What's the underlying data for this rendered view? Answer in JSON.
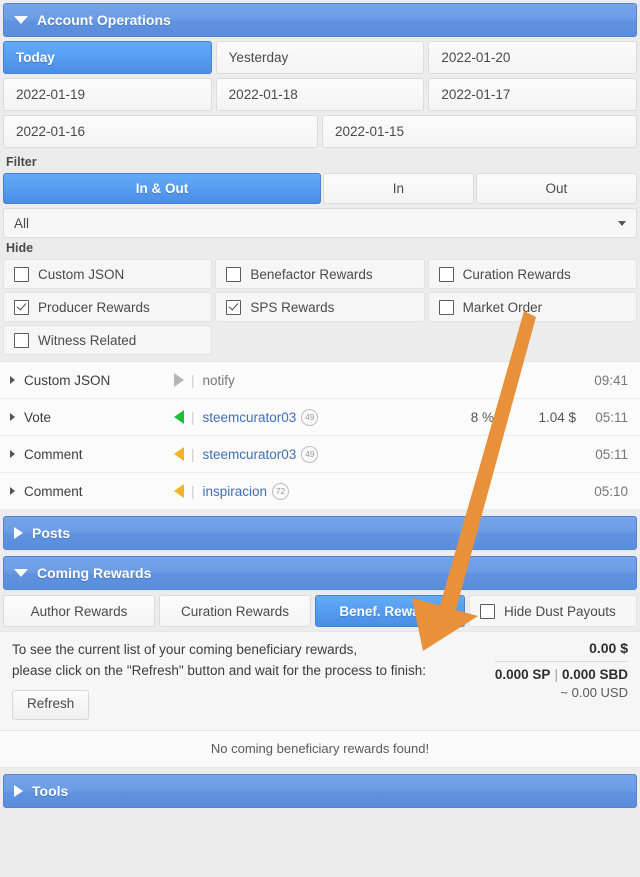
{
  "colors": {
    "header_blue": "#6c9ce5",
    "active_blue": "#58a0f2",
    "arrow_orange": "#e8913a",
    "link_blue": "#3f6fb5",
    "in_green": "#1fbf3e",
    "out_yellow": "#f0b429"
  },
  "account_operations": {
    "title": "Account Operations",
    "collapse_state": "expanded",
    "date_buttons": [
      [
        {
          "label": "Today",
          "active": true
        },
        {
          "label": "Yesterday",
          "active": false
        },
        {
          "label": "2022-01-20",
          "active": false
        }
      ],
      [
        {
          "label": "2022-01-19",
          "active": false
        },
        {
          "label": "2022-01-18",
          "active": false
        },
        {
          "label": "2022-01-17",
          "active": false
        }
      ],
      [
        {
          "label": "2022-01-16",
          "active": false
        },
        {
          "label": "2022-01-15",
          "active": false
        }
      ]
    ],
    "filter_label": "Filter",
    "filter_buttons": [
      {
        "label": "In & Out",
        "active": true
      },
      {
        "label": "In",
        "active": false
      },
      {
        "label": "Out",
        "active": false
      }
    ],
    "filter_select": {
      "value": "All",
      "icon": "chevron-down-icon"
    },
    "hide_label": "Hide",
    "hide_checkboxes": [
      [
        {
          "label": "Custom JSON",
          "checked": false
        },
        {
          "label": "Benefactor Rewards",
          "checked": false
        },
        {
          "label": "Curation Rewards",
          "checked": false
        }
      ],
      [
        {
          "label": "Producer Rewards",
          "checked": true
        },
        {
          "label": "SPS Rewards",
          "checked": true
        },
        {
          "label": "Market Order",
          "checked": false
        }
      ],
      [
        {
          "label": "Witness Related",
          "checked": false
        }
      ]
    ],
    "operations": [
      {
        "type": "Custom JSON",
        "direction": "none",
        "user": "notify",
        "user_is_link": false,
        "reputation": "",
        "percent": "",
        "amount": "",
        "time": "09:41"
      },
      {
        "type": "Vote",
        "direction": "in",
        "user": "steemcurator03",
        "user_is_link": true,
        "reputation": "49",
        "percent": "8 %",
        "amount": "1.04 $",
        "time": "05:11"
      },
      {
        "type": "Comment",
        "direction": "out",
        "user": "steemcurator03",
        "user_is_link": true,
        "reputation": "49",
        "percent": "",
        "amount": "",
        "time": "05:11"
      },
      {
        "type": "Comment",
        "direction": "out",
        "user": "inspiracion",
        "user_is_link": true,
        "reputation": "72",
        "percent": "",
        "amount": "",
        "time": "05:10"
      }
    ]
  },
  "posts_section": {
    "title": "Posts",
    "collapse_state": "collapsed"
  },
  "coming_rewards": {
    "title": "Coming Rewards",
    "collapse_state": "expanded",
    "tabs": [
      {
        "label": "Author Rewards",
        "active": false
      },
      {
        "label": "Curation Rewards",
        "active": false
      },
      {
        "label": "Benef. Rewards",
        "active": true
      }
    ],
    "hide_dust": {
      "label": "Hide Dust Payouts",
      "checked": false
    },
    "instruction_line1": "To see the current list of your coming beneficiary rewards,",
    "instruction_line2": "please click on the \"Refresh\" button and wait for the process to finish:",
    "refresh_label": "Refresh",
    "total_usd": "0.00 $",
    "sp_amount": "0.000 SP",
    "separator": "|",
    "sbd_amount": "0.000 SBD",
    "approx_usd": "~ 0.00 USD",
    "empty_message": "No coming beneficiary rewards found!"
  },
  "tools_section": {
    "title": "Tools",
    "collapse_state": "collapsed"
  },
  "annotation": {
    "type": "arrow-overlay",
    "color": "#e8913a",
    "points_to": "Benef. Rewards"
  }
}
